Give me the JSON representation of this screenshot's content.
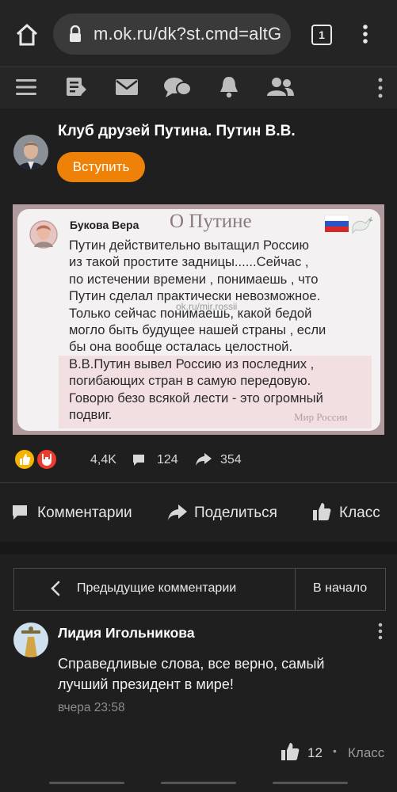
{
  "browser": {
    "url": "m.ok.ru/dk?st.cmd=altG",
    "tab_count": "1"
  },
  "group": {
    "title": "Клуб друзей Путина. Путин В.В.",
    "join_label": "Вступить"
  },
  "post_image": {
    "author": "Букова Вера",
    "heading": "О Путине",
    "text": "Путин действительно вытащил Россию\nиз такой простите задницы......Сейчас ,\nпо истечении времени , понимаешь , что\nПутин сделал практически невозможное.\nТолько сейчас понимаешь, какой бедой\nмогло быть будущее нашей страны , если\nбы она вообще осталась целостной.\nВ.В.Путин вывел Россию из последних ,\nпогибающих стран в самую передовую.\nГоворю безо всякой лести - это огромный\nподвиг.",
    "watermark": "ok.ru/mir.rossii",
    "signature": "Мир России"
  },
  "stats": {
    "reactions": "4,4K",
    "comments": "124",
    "shares": "354"
  },
  "actions": {
    "comments_label": "Комментарии",
    "share_label": "Поделиться",
    "like_label": "Класс"
  },
  "comments_nav": {
    "previous_label": "Предыдущие комментарии",
    "to_start_label": "В начало"
  },
  "comment": {
    "author": "Лидия Игольникова",
    "text": "Справедливые слова, все верно, самый лучший президент в мире!",
    "time": "вчера 23:58",
    "likes": "12",
    "like_label": "Класс",
    "separator": "•"
  },
  "colors": {
    "accent": "#ee8208",
    "background": "#1f1f1f"
  },
  "icons": [
    "home-icon",
    "lock-icon",
    "more-vertical-icon",
    "menu-icon",
    "feed-icon",
    "mail-icon",
    "chat-icon",
    "bell-icon",
    "friends-icon",
    "comment-icon",
    "share-icon",
    "like-icon",
    "chevron-left-icon"
  ]
}
